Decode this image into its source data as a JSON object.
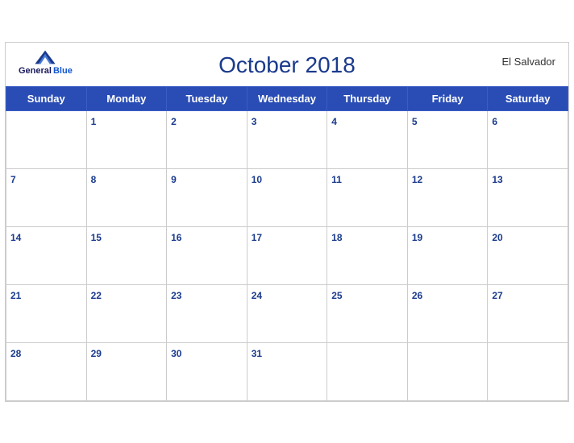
{
  "calendar": {
    "title": "October 2018",
    "country": "El Salvador",
    "logo": {
      "general": "General",
      "blue": "Blue"
    },
    "days_of_week": [
      "Sunday",
      "Monday",
      "Tuesday",
      "Wednesday",
      "Thursday",
      "Friday",
      "Saturday"
    ],
    "weeks": [
      [
        null,
        1,
        2,
        3,
        4,
        5,
        6
      ],
      [
        7,
        8,
        9,
        10,
        11,
        12,
        13
      ],
      [
        14,
        15,
        16,
        17,
        18,
        19,
        20
      ],
      [
        21,
        22,
        23,
        24,
        25,
        26,
        27
      ],
      [
        28,
        29,
        30,
        31,
        null,
        null,
        null
      ]
    ]
  }
}
